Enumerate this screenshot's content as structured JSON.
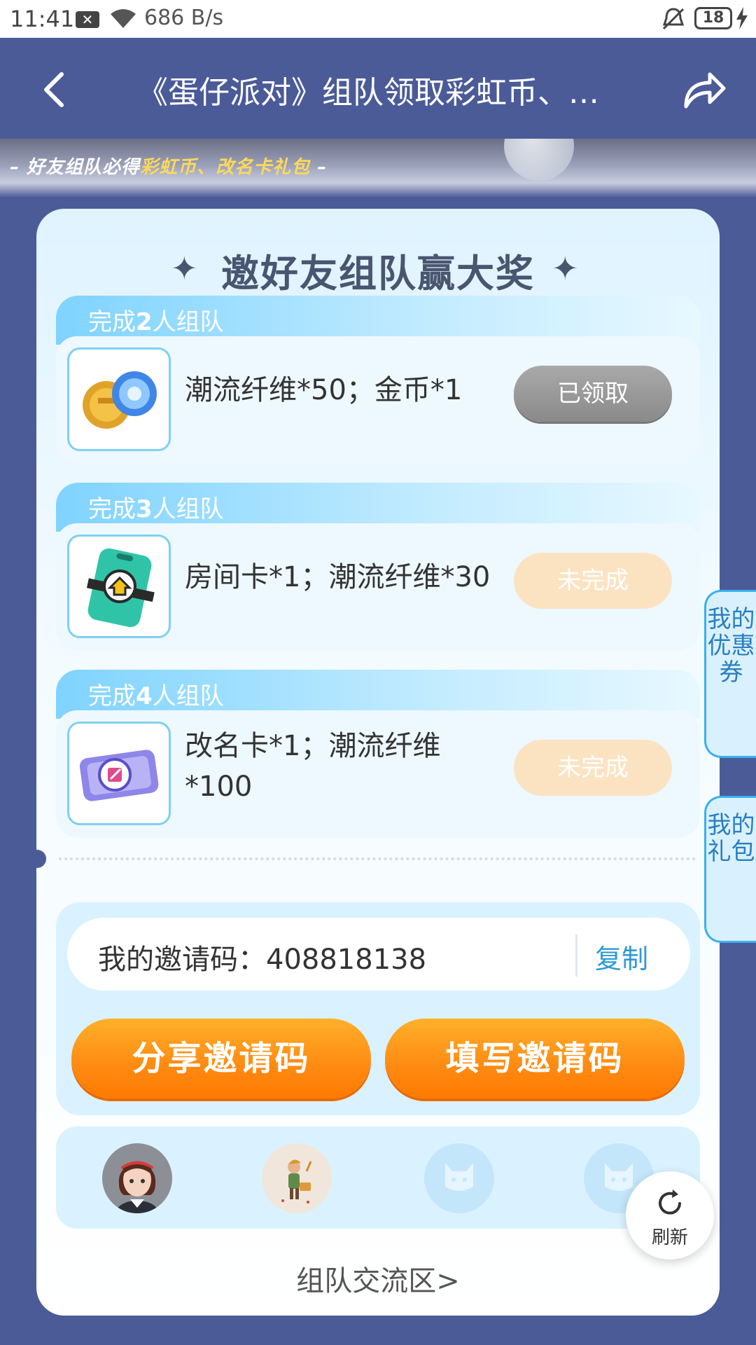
{
  "status_bar": {
    "time": "11:41",
    "x_badge": "✕",
    "speed": "686 B/s",
    "battery": "18"
  },
  "nav": {
    "title": "《蛋仔派对》组队领取彩虹币、…"
  },
  "banner": {
    "subtitle_prefix": "– 好友组队必得",
    "subtitle_highlight": "彩虹币、改名卡礼包",
    "subtitle_suffix": " –"
  },
  "section": {
    "title": "邀好友组队赢大奖",
    "sparkle": "✦"
  },
  "tasks": [
    {
      "head_prefix": "完成",
      "count": "2",
      "head_suffix": "人组队",
      "reward": "潮流纤维*50；金币*1",
      "button": "已领取",
      "status": "claimed"
    },
    {
      "head_prefix": "完成",
      "count": "3",
      "head_suffix": "人组队",
      "reward": "房间卡*1；潮流纤维*30",
      "button": "未完成",
      "status": "incomplete"
    },
    {
      "head_prefix": "完成",
      "count": "4",
      "head_suffix": "人组队",
      "reward": "改名卡*1；潮流纤维*100",
      "button": "未完成",
      "status": "incomplete"
    }
  ],
  "side_tabs": {
    "coupons": "我的优惠券",
    "gifts": "我的礼包"
  },
  "invite": {
    "label": "我的邀请码：",
    "code": "408818138",
    "copy": "复制",
    "share_button": "分享邀请码",
    "fill_button": "填写邀请码"
  },
  "refresh": {
    "label": "刷新"
  },
  "forum": {
    "link": "组队交流区>"
  },
  "colors": {
    "page_bg": "#4b5b98",
    "accent_orange": "#ff8a12",
    "accent_blue": "#2d9ad6"
  }
}
